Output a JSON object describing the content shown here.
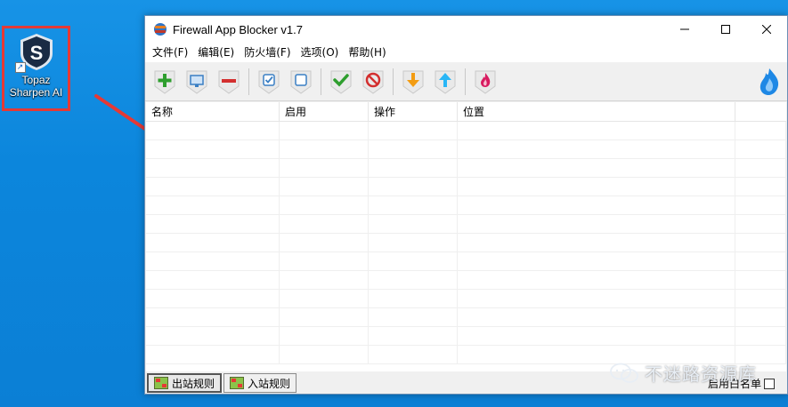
{
  "desktop": {
    "icon_label_line1": "Topaz",
    "icon_label_line2": "Sharpen AI"
  },
  "window": {
    "title": "Firewall App Blocker v1.7",
    "menu": [
      "文件(F)",
      "编辑(E)",
      "防火墙(F)",
      "选项(O)",
      "帮助(H)"
    ],
    "toolbar": [
      {
        "icon": "add-icon",
        "color": "#2e9e2e"
      },
      {
        "icon": "monitor-icon",
        "color": "#3a7fc4"
      },
      {
        "icon": "remove-icon",
        "color": "#d32f2f"
      },
      {
        "icon": "checkbox-checked-icon",
        "color": "#3a7fc4"
      },
      {
        "icon": "checkbox-empty-icon",
        "color": "#3a7fc4"
      },
      {
        "icon": "enable-check-icon",
        "color": "#2e9e2e"
      },
      {
        "icon": "block-icon",
        "color": "#d32f2f"
      },
      {
        "icon": "arrow-down-icon",
        "color": "#f39c12"
      },
      {
        "icon": "arrow-up-icon",
        "color": "#29b6f6"
      },
      {
        "icon": "firewall-flame-icon",
        "color": "#d81b60"
      }
    ],
    "columns": [
      "名称",
      "启用",
      "操作",
      "位置"
    ],
    "tabs": [
      {
        "label": "出站规则",
        "active": true
      },
      {
        "label": "入站规则",
        "active": false
      }
    ],
    "whitelist_label": "启用白名单",
    "whitelist_checked": false
  },
  "watermark": "不迷路资源库"
}
